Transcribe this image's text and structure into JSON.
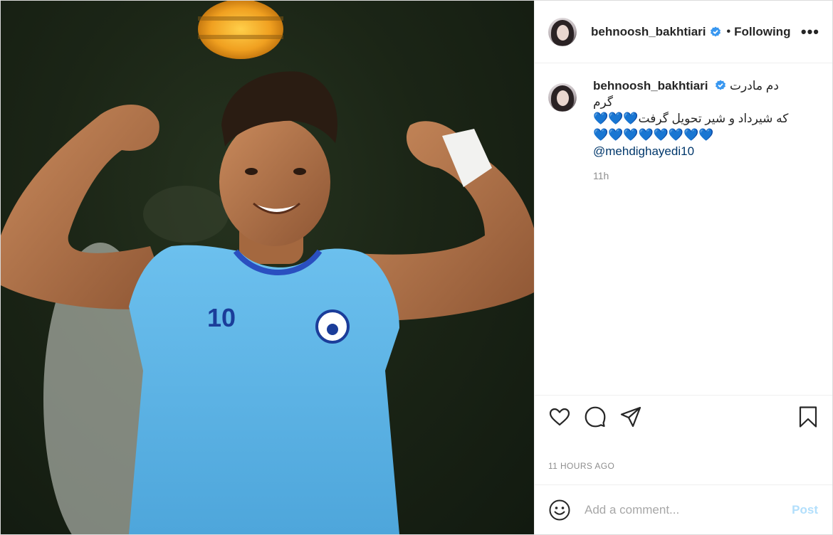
{
  "post": {
    "author": {
      "username": "behnoosh_bakhtiari",
      "verified": true,
      "follow_state": "Following",
      "separator": "•"
    },
    "more_label": "•••",
    "caption": {
      "username": "behnoosh_bakhtiari",
      "line1": "دم مادرت گرم",
      "line2": "که شیرداد و شیر تحویل گرفت",
      "hearts_line2": "💙💙💙",
      "hearts_line3": "💙💙💙💙💙💙💙💙",
      "mention": "@mehdighayedi10",
      "time": "11h"
    },
    "photo": {
      "jersey_number": "10",
      "accent_jersey": "#5ab4e6",
      "background": "#1b2516"
    },
    "actions": {
      "like_icon": "heart-icon",
      "comment_icon": "comment-icon",
      "share_icon": "share-icon",
      "save_icon": "bookmark-icon"
    },
    "timestamp": "11 HOURS AGO",
    "add_comment": {
      "placeholder": "Add a comment...",
      "post_label": "Post",
      "emoji_icon": "smiley-icon"
    },
    "colors": {
      "verified": "#3897f0",
      "hearts": "#1ab0ea",
      "post_button_disabled": "#b2dffc",
      "mention": "#00376b"
    }
  }
}
